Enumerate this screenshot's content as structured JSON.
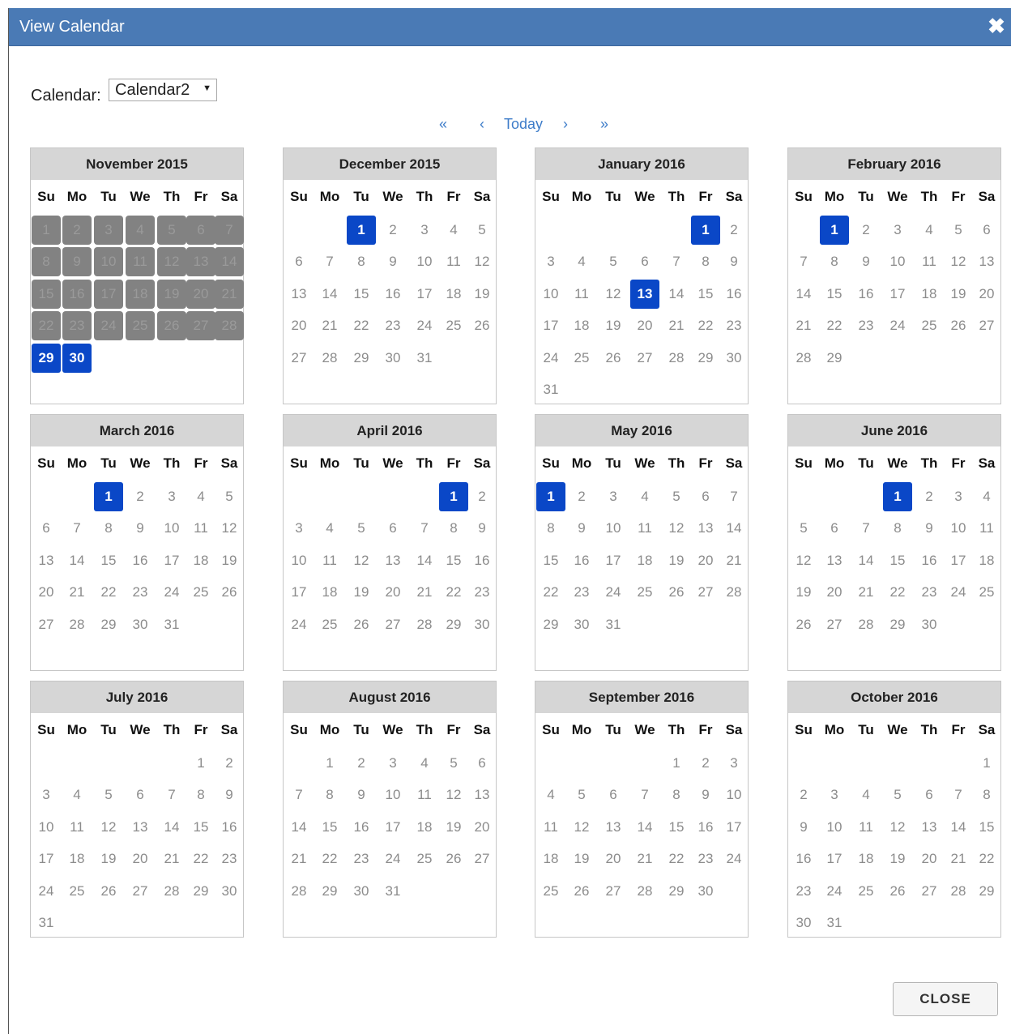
{
  "dialog": {
    "title": "View Calendar",
    "close_icon": "✖"
  },
  "calendar_select": {
    "label": "Calendar:",
    "value": "Calendar2",
    "arrow": "▼"
  },
  "nav": {
    "first": "«",
    "prev": "‹",
    "today": "Today",
    "next": "›",
    "last": "»"
  },
  "weekday_labels": [
    "Su",
    "Mo",
    "Tu",
    "We",
    "Th",
    "Fr",
    "Sa"
  ],
  "months": [
    {
      "name": "November 2015",
      "first_weekday": 0,
      "days": 30,
      "selected": [
        29,
        30
      ],
      "past_until": 28
    },
    {
      "name": "December 2015",
      "first_weekday": 2,
      "days": 31,
      "selected": [
        1
      ]
    },
    {
      "name": "January 2016",
      "first_weekday": 5,
      "days": 31,
      "selected": [
        1,
        13
      ]
    },
    {
      "name": "February 2016",
      "first_weekday": 1,
      "days": 29,
      "selected": [
        1
      ]
    },
    {
      "name": "March 2016",
      "first_weekday": 2,
      "days": 31,
      "selected": [
        1
      ]
    },
    {
      "name": "April 2016",
      "first_weekday": 5,
      "days": 30,
      "selected": [
        1
      ]
    },
    {
      "name": "May 2016",
      "first_weekday": 0,
      "days": 31,
      "selected": [
        1
      ]
    },
    {
      "name": "June 2016",
      "first_weekday": 3,
      "days": 30,
      "selected": [
        1
      ]
    },
    {
      "name": "July 2016",
      "first_weekday": 5,
      "days": 31,
      "selected": []
    },
    {
      "name": "August 2016",
      "first_weekday": 1,
      "days": 31,
      "selected": []
    },
    {
      "name": "September 2016",
      "first_weekday": 4,
      "days": 30,
      "selected": []
    },
    {
      "name": "October 2016",
      "first_weekday": 6,
      "days": 31,
      "selected": []
    }
  ],
  "footer": {
    "close_label": "CLOSE"
  }
}
